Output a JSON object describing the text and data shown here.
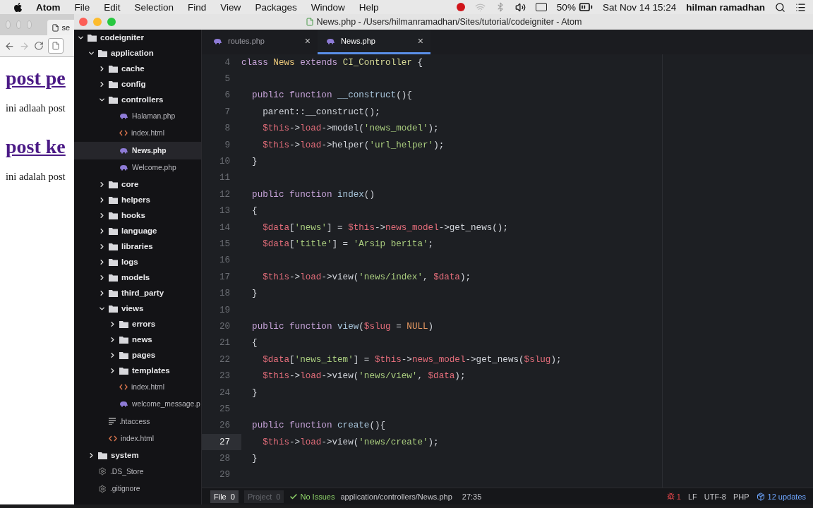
{
  "menu_bar": {
    "app": "Atom",
    "items": [
      "File",
      "Edit",
      "Selection",
      "Find",
      "View",
      "Packages",
      "Window",
      "Help"
    ],
    "battery": "50%",
    "clock": "Sat Nov 14 15:24",
    "user": "hilman ramadhan"
  },
  "browser": {
    "tab": "se",
    "heading_1": "post pe",
    "text_1": "ini adlaah post",
    "heading_2": "post ke",
    "text_2": "ini adalah post"
  },
  "window": {
    "title": "News.php - /Users/hilmanramadhan/Sites/tutorial/codeigniter - Atom"
  },
  "tree": [
    {
      "label": "codeigniter",
      "kind": "folder",
      "expanded": true,
      "selected": false,
      "children": [
        {
          "label": "application",
          "kind": "folder",
          "expanded": true,
          "selected": false,
          "children": [
            {
              "label": "cache",
              "kind": "folder",
              "expanded": false,
              "selected": false
            },
            {
              "label": "config",
              "kind": "folder",
              "expanded": false,
              "selected": false
            },
            {
              "label": "controllers",
              "kind": "folder",
              "expanded": true,
              "selected": false,
              "children": [
                {
                  "label": "Halaman.php",
                  "kind": "php",
                  "selected": false
                },
                {
                  "label": "index.html",
                  "kind": "html",
                  "selected": false
                },
                {
                  "label": "News.php",
                  "kind": "php",
                  "selected": true
                },
                {
                  "label": "Welcome.php",
                  "kind": "php",
                  "selected": false
                }
              ]
            },
            {
              "label": "core",
              "kind": "folder",
              "expanded": false,
              "selected": false
            },
            {
              "label": "helpers",
              "kind": "folder",
              "expanded": false,
              "selected": false
            },
            {
              "label": "hooks",
              "kind": "folder",
              "expanded": false,
              "selected": false
            },
            {
              "label": "language",
              "kind": "folder",
              "expanded": false,
              "selected": false
            },
            {
              "label": "libraries",
              "kind": "folder",
              "expanded": false,
              "selected": false
            },
            {
              "label": "logs",
              "kind": "folder",
              "expanded": false,
              "selected": false
            },
            {
              "label": "models",
              "kind": "folder",
              "expanded": false,
              "selected": false
            },
            {
              "label": "third_party",
              "kind": "folder",
              "expanded": false,
              "selected": false
            },
            {
              "label": "views",
              "kind": "folder",
              "expanded": true,
              "selected": false,
              "children": [
                {
                  "label": "errors",
                  "kind": "folder",
                  "expanded": false,
                  "selected": false
                },
                {
                  "label": "news",
                  "kind": "folder",
                  "expanded": false,
                  "selected": false
                },
                {
                  "label": "pages",
                  "kind": "folder",
                  "expanded": false,
                  "selected": false
                },
                {
                  "label": "templates",
                  "kind": "folder",
                  "expanded": false,
                  "selected": false
                },
                {
                  "label": "index.html",
                  "kind": "html",
                  "selected": false
                },
                {
                  "label": "welcome_message.p",
                  "kind": "php",
                  "selected": false
                }
              ]
            },
            {
              "label": ".htaccess",
              "kind": "text",
              "selected": false
            },
            {
              "label": "index.html",
              "kind": "html",
              "selected": false
            }
          ]
        },
        {
          "label": "system",
          "kind": "folder",
          "expanded": false,
          "selected": false
        },
        {
          "label": ".DS_Store",
          "kind": "config",
          "selected": false
        },
        {
          "label": ".gitignore",
          "kind": "config",
          "selected": false
        }
      ]
    }
  ],
  "tabs": [
    {
      "label": "routes.php",
      "selected": false,
      "close": "×"
    },
    {
      "label": "News.php",
      "selected": true,
      "close": "×"
    }
  ],
  "code": [
    {
      "number": "4",
      "active": false,
      "tokens": [
        {
          "kind": "kw",
          "text": "class "
        },
        {
          "kind": "cls",
          "text": "News"
        },
        {
          "kind": "kw",
          "text": " extends "
        },
        {
          "kind": "parent",
          "text": "CI_Controller"
        },
        {
          "kind": "plain",
          "text": " {"
        }
      ]
    },
    {
      "number": "5",
      "active": false
    },
    {
      "number": "6",
      "active": false,
      "tokens": [
        {
          "kind": "kw",
          "text": "  public function "
        },
        {
          "kind": "fn",
          "text": "__construct"
        },
        {
          "kind": "plain",
          "text": "(){"
        }
      ]
    },
    {
      "number": "7",
      "active": false,
      "tokens": [
        {
          "kind": "plain",
          "text": "    parent::__construct();"
        }
      ]
    },
    {
      "number": "8",
      "active": false,
      "tokens": [
        {
          "kind": "var",
          "text": "    $this"
        },
        {
          "kind": "plain",
          "text": "->"
        },
        {
          "kind": "prop",
          "text": "load"
        },
        {
          "kind": "plain",
          "text": "->model("
        },
        {
          "kind": "str",
          "text": "'news_model'"
        },
        {
          "kind": "plain",
          "text": ");"
        }
      ]
    },
    {
      "number": "9",
      "active": false,
      "tokens": [
        {
          "kind": "var",
          "text": "    $this"
        },
        {
          "kind": "plain",
          "text": "->"
        },
        {
          "kind": "prop",
          "text": "load"
        },
        {
          "kind": "plain",
          "text": "->helper("
        },
        {
          "kind": "str",
          "text": "'url_helper'"
        },
        {
          "kind": "plain",
          "text": ");"
        }
      ]
    },
    {
      "number": "10",
      "active": false,
      "tokens": [
        {
          "kind": "plain",
          "text": "  }"
        }
      ]
    },
    {
      "number": "11",
      "active": false
    },
    {
      "number": "12",
      "active": false,
      "tokens": [
        {
          "kind": "kw",
          "text": "  public function "
        },
        {
          "kind": "fn",
          "text": "index"
        },
        {
          "kind": "plain",
          "text": "()"
        }
      ]
    },
    {
      "number": "13",
      "active": false,
      "tokens": [
        {
          "kind": "plain",
          "text": "  {"
        }
      ]
    },
    {
      "number": "14",
      "active": false,
      "tokens": [
        {
          "kind": "var",
          "text": "    $data"
        },
        {
          "kind": "plain",
          "text": "["
        },
        {
          "kind": "str",
          "text": "'news'"
        },
        {
          "kind": "plain",
          "text": "] = "
        },
        {
          "kind": "var",
          "text": "$this"
        },
        {
          "kind": "plain",
          "text": "->"
        },
        {
          "kind": "prop",
          "text": "news_model"
        },
        {
          "kind": "plain",
          "text": "->get_news();"
        }
      ]
    },
    {
      "number": "15",
      "active": false,
      "tokens": [
        {
          "kind": "var",
          "text": "    $data"
        },
        {
          "kind": "plain",
          "text": "["
        },
        {
          "kind": "str",
          "text": "'title'"
        },
        {
          "kind": "plain",
          "text": "] = "
        },
        {
          "kind": "str",
          "text": "'Arsip berita'"
        },
        {
          "kind": "plain",
          "text": ";"
        }
      ]
    },
    {
      "number": "16",
      "active": false
    },
    {
      "number": "17",
      "active": false,
      "tokens": [
        {
          "kind": "var",
          "text": "    $this"
        },
        {
          "kind": "plain",
          "text": "->"
        },
        {
          "kind": "prop",
          "text": "load"
        },
        {
          "kind": "plain",
          "text": "->view("
        },
        {
          "kind": "str",
          "text": "'news/index'"
        },
        {
          "kind": "plain",
          "text": ", "
        },
        {
          "kind": "var",
          "text": "$data"
        },
        {
          "kind": "plain",
          "text": ");"
        }
      ]
    },
    {
      "number": "18",
      "active": false,
      "tokens": [
        {
          "kind": "plain",
          "text": "  }"
        }
      ]
    },
    {
      "number": "19",
      "active": false
    },
    {
      "number": "20",
      "active": false,
      "tokens": [
        {
          "kind": "kw",
          "text": "  public function "
        },
        {
          "kind": "fn",
          "text": "view"
        },
        {
          "kind": "plain",
          "text": "("
        },
        {
          "kind": "var",
          "text": "$slug"
        },
        {
          "kind": "plain",
          "text": " = "
        },
        {
          "kind": "const",
          "text": "NULL"
        },
        {
          "kind": "plain",
          "text": ")"
        }
      ]
    },
    {
      "number": "21",
      "active": false,
      "tokens": [
        {
          "kind": "plain",
          "text": "  {"
        }
      ]
    },
    {
      "number": "22",
      "active": false,
      "tokens": [
        {
          "kind": "var",
          "text": "    $data"
        },
        {
          "kind": "plain",
          "text": "["
        },
        {
          "kind": "str",
          "text": "'news_item'"
        },
        {
          "kind": "plain",
          "text": "] = "
        },
        {
          "kind": "var",
          "text": "$this"
        },
        {
          "kind": "plain",
          "text": "->"
        },
        {
          "kind": "prop",
          "text": "news_model"
        },
        {
          "kind": "plain",
          "text": "->get_news("
        },
        {
          "kind": "var",
          "text": "$slug"
        },
        {
          "kind": "plain",
          "text": ");"
        }
      ]
    },
    {
      "number": "23",
      "active": false,
      "tokens": [
        {
          "kind": "var",
          "text": "    $this"
        },
        {
          "kind": "plain",
          "text": "->"
        },
        {
          "kind": "prop",
          "text": "load"
        },
        {
          "kind": "plain",
          "text": "->view("
        },
        {
          "kind": "str",
          "text": "'news/view'"
        },
        {
          "kind": "plain",
          "text": ", "
        },
        {
          "kind": "var",
          "text": "$data"
        },
        {
          "kind": "plain",
          "text": ");"
        }
      ]
    },
    {
      "number": "24",
      "active": false,
      "tokens": [
        {
          "kind": "plain",
          "text": "  }"
        }
      ]
    },
    {
      "number": "25",
      "active": false
    },
    {
      "number": "26",
      "active": false,
      "tokens": [
        {
          "kind": "kw",
          "text": "  public function "
        },
        {
          "kind": "fn",
          "text": "create"
        },
        {
          "kind": "plain",
          "text": "(){"
        }
      ]
    },
    {
      "number": "27",
      "active": true,
      "tokens": [
        {
          "kind": "var",
          "text": "    $this"
        },
        {
          "kind": "plain",
          "text": "->"
        },
        {
          "kind": "prop",
          "text": "load"
        },
        {
          "kind": "plain",
          "text": "->view("
        },
        {
          "kind": "str",
          "text": "'news/create'"
        },
        {
          "kind": "plain",
          "text": ");"
        }
      ]
    },
    {
      "number": "28",
      "active": false,
      "tokens": [
        {
          "kind": "plain",
          "text": "  }"
        }
      ]
    },
    {
      "number": "29",
      "active": false
    }
  ],
  "status_bar": {
    "file_tab": {
      "label": "File",
      "count": "0",
      "selected": true
    },
    "project_tab": {
      "label": "Project",
      "count": "0",
      "selected": false
    },
    "issues": "No Issues",
    "path": "application/controllers/News.php",
    "cursor": "27:35",
    "errors": "1",
    "line_ending": "LF",
    "encoding": "UTF-8",
    "grammar": "PHP",
    "updates": "12 updates"
  }
}
